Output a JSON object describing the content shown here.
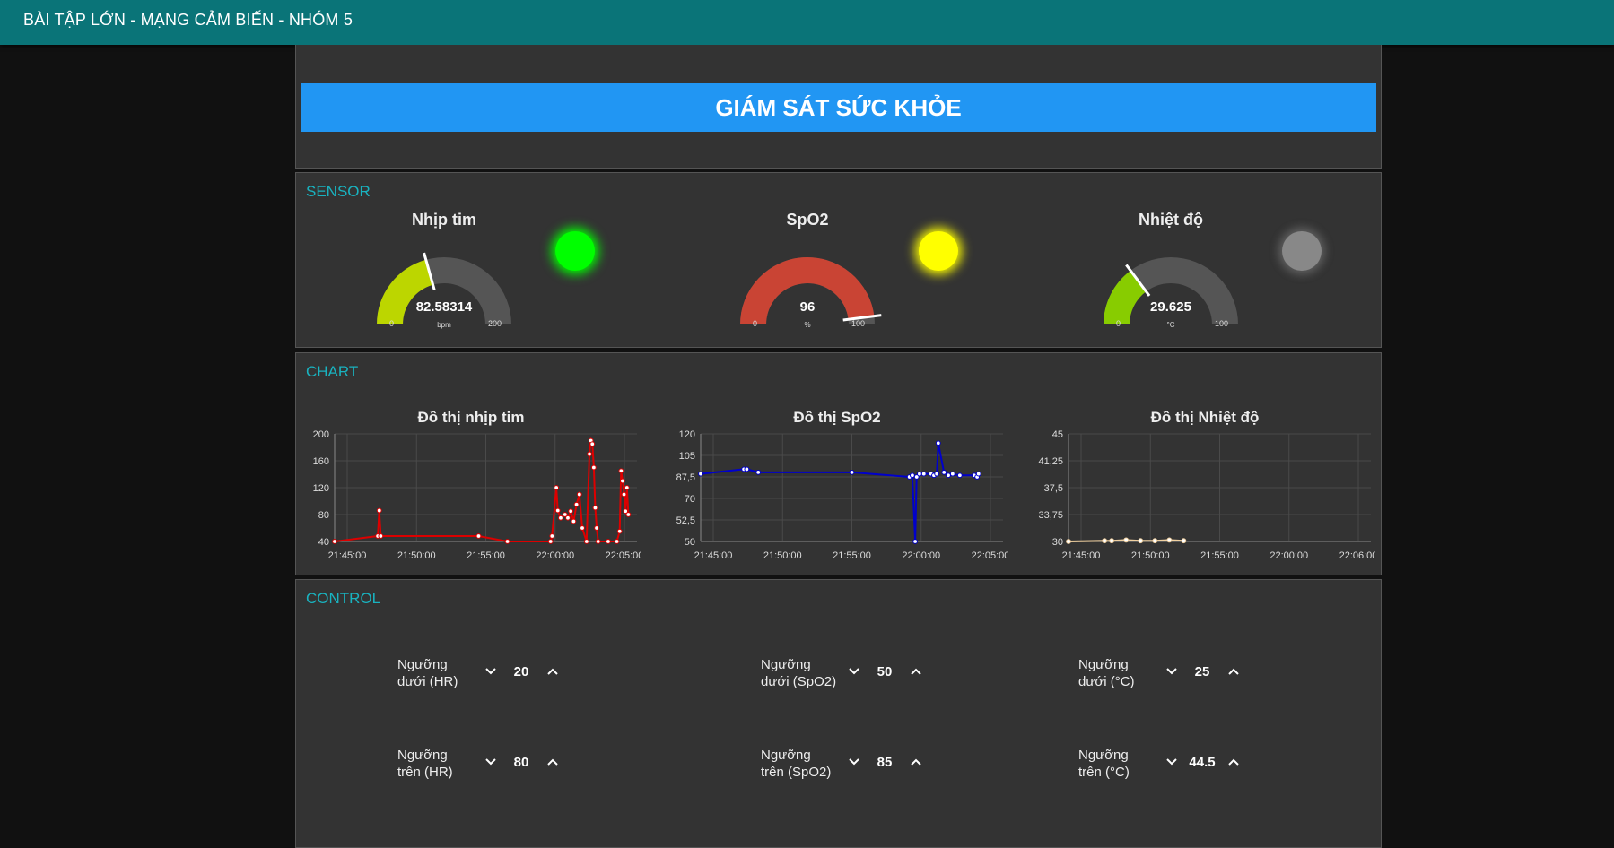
{
  "app": {
    "title": "BÀI TẬP LỚN - MẠNG CẢM BIẾN - NHÓM 5"
  },
  "header": {
    "banner": "GIÁM SÁT SỨC KHỎE"
  },
  "sensor": {
    "label": "SENSOR",
    "gauges": [
      {
        "title": "Nhịp tim",
        "value": "82.58314",
        "unit": "bpm",
        "min": "0",
        "max": "200",
        "level": 0.413,
        "color": "#bcd600"
      },
      {
        "title": "SpO2",
        "value": "96",
        "unit": "%",
        "min": "0",
        "max": "100",
        "level": 0.96,
        "color": "#c94434"
      },
      {
        "title": "Nhiệt độ",
        "value": "29.625",
        "unit": "°C",
        "min": "0",
        "max": "100",
        "level": 0.296,
        "color": "#88cc00"
      }
    ],
    "leds": [
      {
        "state": "on",
        "color": "#00ff00"
      },
      {
        "state": "on",
        "color": "#ffff00"
      },
      {
        "state": "off",
        "color": "#888888"
      }
    ]
  },
  "chart": {
    "label": "CHART"
  },
  "chart_data": [
    {
      "type": "line",
      "title": "Đồ thị nhịp tim",
      "color": "#dd0000",
      "xticks": [
        "21:45:00",
        "21:50:00",
        "21:55:00",
        "22:00:00",
        "22:05:00"
      ],
      "yticks": [
        "40",
        "80",
        "120",
        "160",
        "200"
      ],
      "xlim": [
        0,
        21
      ],
      "ylim": [
        40,
        200
      ],
      "points": [
        [
          0,
          40
        ],
        [
          3,
          48
        ],
        [
          3.1,
          86
        ],
        [
          3.2,
          48
        ],
        [
          10,
          48
        ],
        [
          12,
          40
        ],
        [
          15,
          40
        ],
        [
          15.1,
          48
        ],
        [
          15.4,
          120
        ],
        [
          15.5,
          86
        ],
        [
          15.7,
          75
        ],
        [
          16,
          80
        ],
        [
          16.2,
          75
        ],
        [
          16.4,
          85
        ],
        [
          16.6,
          70
        ],
        [
          16.8,
          95
        ],
        [
          17,
          110
        ],
        [
          17.2,
          60
        ],
        [
          17.5,
          40
        ],
        [
          17.7,
          170
        ],
        [
          17.8,
          190
        ],
        [
          17.9,
          185
        ],
        [
          18,
          150
        ],
        [
          18.1,
          90
        ],
        [
          18.2,
          60
        ],
        [
          18.3,
          40
        ],
        [
          19,
          40
        ],
        [
          19.6,
          40
        ],
        [
          19.8,
          55
        ],
        [
          19.9,
          145
        ],
        [
          20,
          130
        ],
        [
          20.1,
          110
        ],
        [
          20.2,
          85
        ],
        [
          20.3,
          120
        ],
        [
          20.4,
          80
        ]
      ]
    },
    {
      "type": "line",
      "title": "Đồ thị SpO2",
      "color": "#0000cc",
      "xticks": [
        "21:45:00",
        "21:50:00",
        "21:55:00",
        "22:00:00",
        "22:05:00"
      ],
      "yticks": [
        "50",
        "52,5",
        "70",
        "87,5",
        "105",
        "120"
      ],
      "xlim": [
        0,
        21
      ],
      "ylim": [
        50,
        120
      ],
      "points": [
        [
          0,
          94
        ],
        [
          3,
          97
        ],
        [
          3.2,
          97
        ],
        [
          4,
          95
        ],
        [
          10.5,
          95
        ],
        [
          14.5,
          92
        ],
        [
          14.7,
          93
        ],
        [
          14.9,
          50
        ],
        [
          15,
          92
        ],
        [
          15.2,
          94
        ],
        [
          15.5,
          94
        ],
        [
          16,
          94
        ],
        [
          16.2,
          93
        ],
        [
          16.4,
          94
        ],
        [
          16.5,
          114
        ],
        [
          16.9,
          95
        ],
        [
          17.2,
          93
        ],
        [
          17.5,
          94
        ],
        [
          18,
          93
        ],
        [
          19,
          93
        ],
        [
          19.2,
          92
        ],
        [
          19.3,
          94
        ]
      ]
    },
    {
      "type": "line",
      "title": "Đồ thị Nhiệt độ",
      "color": "#f0d0a0",
      "xticks": [
        "21:45:00",
        "21:50:00",
        "21:55:00",
        "22:00:00",
        "22:06:00"
      ],
      "yticks": [
        "30",
        "33,75",
        "37,5",
        "41,25",
        "45"
      ],
      "xlim": [
        0,
        21
      ],
      "ylim": [
        30,
        45
      ],
      "points": [
        [
          0,
          30
        ],
        [
          2.5,
          30.1
        ],
        [
          3,
          30.1
        ],
        [
          4,
          30.2
        ],
        [
          5,
          30.1
        ],
        [
          6,
          30.1
        ],
        [
          7,
          30.2
        ],
        [
          8,
          30.1
        ]
      ]
    }
  ],
  "control": {
    "label": "CONTROL",
    "items": [
      {
        "label_line1": "Ngưỡng",
        "label_line2": "dưới (HR)",
        "value": "20"
      },
      {
        "label_line1": "Ngưỡng",
        "label_line2": "dưới (SpO2)",
        "value": "50"
      },
      {
        "label_line1": "Ngưỡng",
        "label_line2": "dưới (°C)",
        "value": "25"
      },
      {
        "label_line1": "Ngưỡng",
        "label_line2": "trên (HR)",
        "value": "80"
      },
      {
        "label_line1": "Ngưỡng",
        "label_line2": "trên (SpO2)",
        "value": "85"
      },
      {
        "label_line1": "Ngưỡng",
        "label_line2": "trên (°C)",
        "value": "44.5"
      }
    ],
    "icons": {
      "down": "chevron-down-icon",
      "up": "chevron-up-icon"
    }
  }
}
